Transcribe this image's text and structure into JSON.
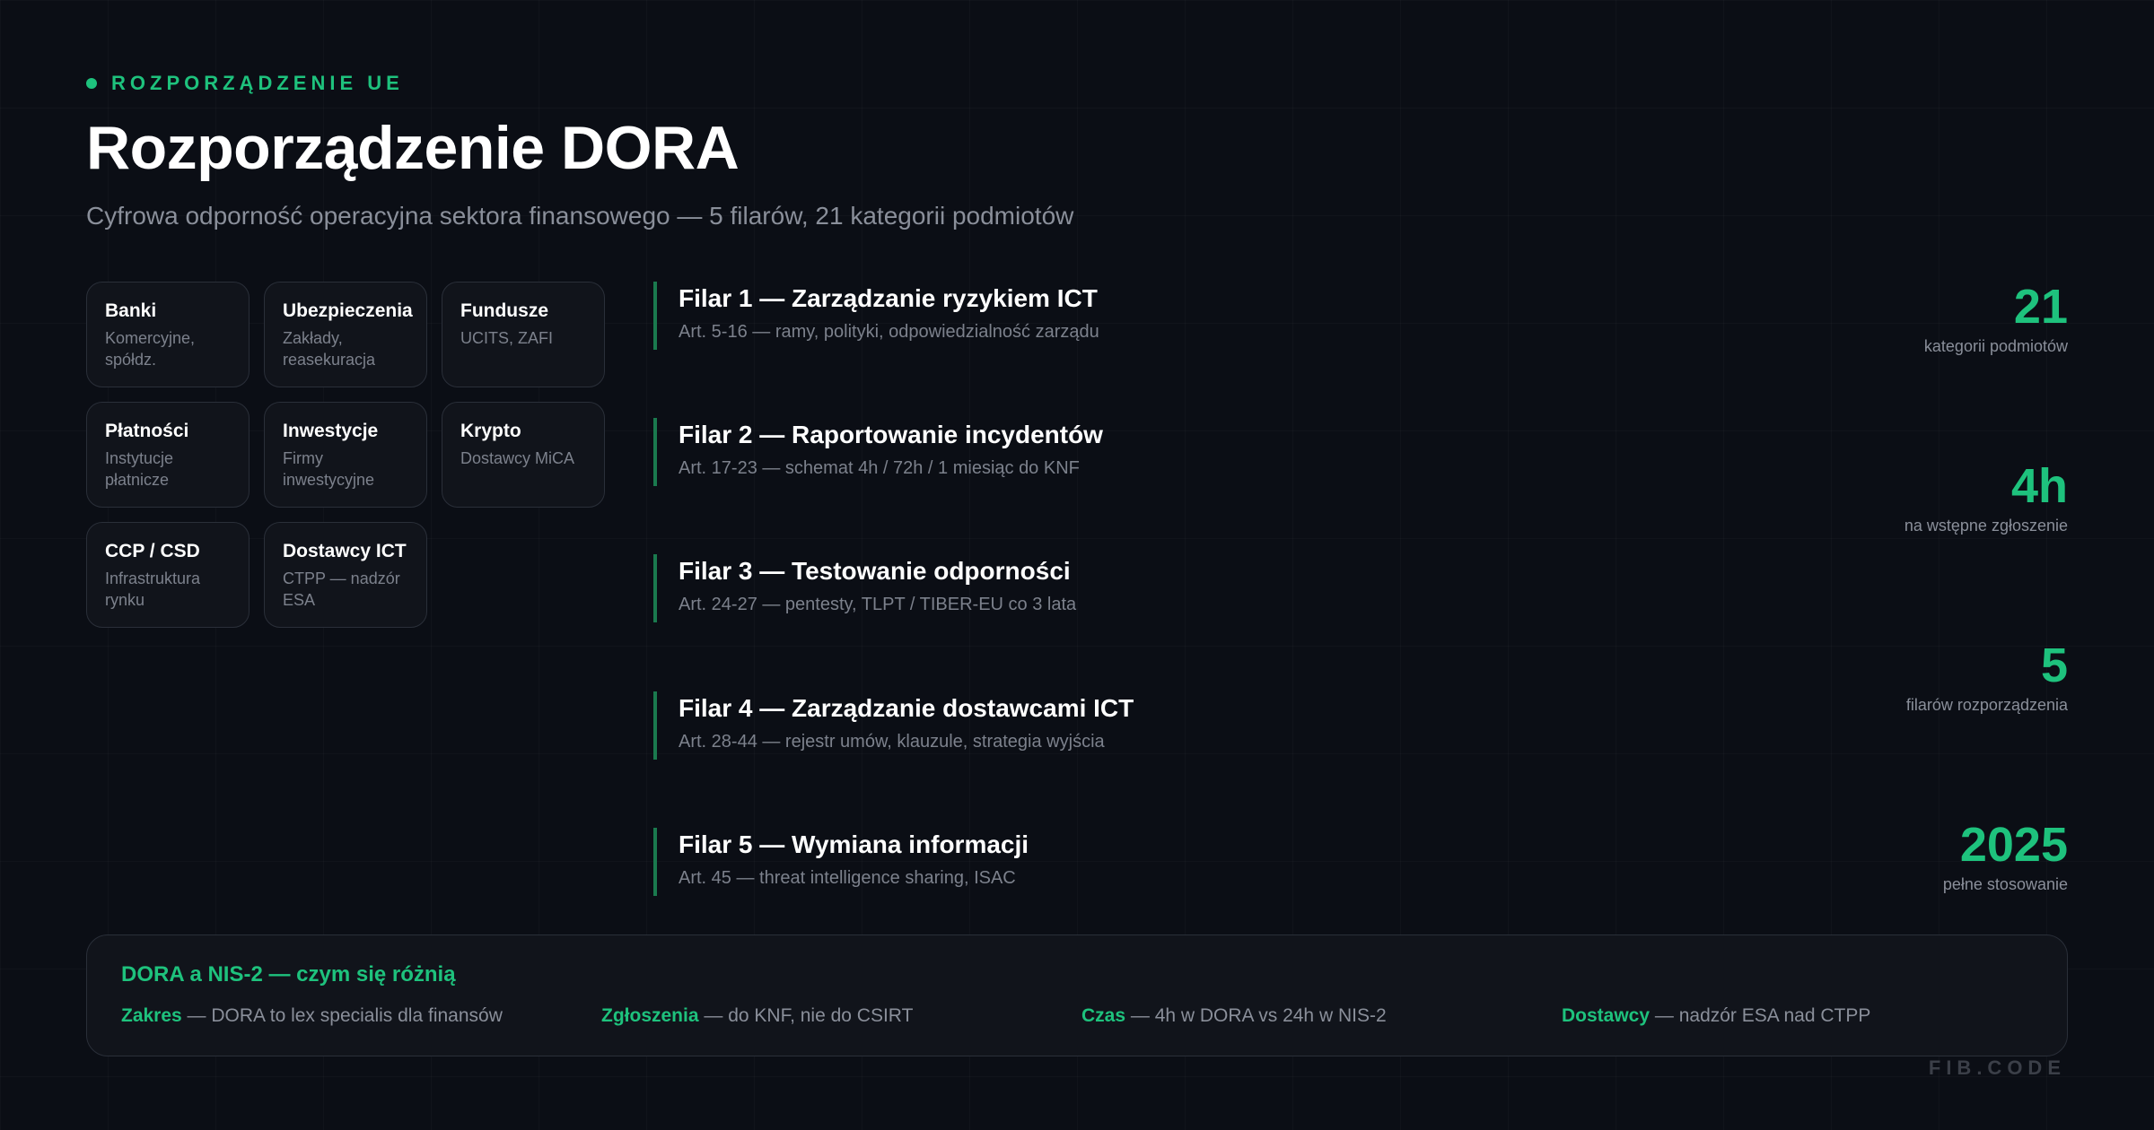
{
  "colors": {
    "accent": "#1ec27d",
    "pillar_bar": "#1a7a4e",
    "muted": "#8a8f9a",
    "background": "#0b0e15"
  },
  "eyebrow": "ROZPORZĄDZENIE UE",
  "title": "Rozporządzenie DORA",
  "subtitle": "Cyfrowa odporność operacyjna sektora finansowego — 5 filarów, 21 kategorii podmiotów",
  "categories": [
    {
      "title": "Banki",
      "desc": "Komercyjne, spółdz."
    },
    {
      "title": "Ubezpieczenia",
      "desc": "Zakłady, reasekuracja"
    },
    {
      "title": "Fundusze",
      "desc": "UCITS, ZAFI"
    },
    {
      "title": "Płatności",
      "desc": "Instytucje płatnicze"
    },
    {
      "title": "Inwestycje",
      "desc": "Firmy inwestycyjne"
    },
    {
      "title": "Krypto",
      "desc": "Dostawcy MiCA"
    },
    {
      "title": "CCP / CSD",
      "desc": "Infrastruktura rynku"
    },
    {
      "title": "Dostawcy ICT",
      "desc": "CTPP — nadzór ESA"
    }
  ],
  "pillars": [
    {
      "title": "Filar 1 — Zarządzanie ryzykiem ICT",
      "desc": "Art. 5-16 — ramy, polityki, odpowiedzialność zarządu"
    },
    {
      "title": "Filar 2 — Raportowanie incydentów",
      "desc": "Art. 17-23 — schemat 4h / 72h / 1 miesiąc do KNF"
    },
    {
      "title": "Filar 3 — Testowanie odporności",
      "desc": "Art. 24-27 — pentesty, TLPT / TIBER-EU co 3 lata"
    },
    {
      "title": "Filar 4 — Zarządzanie dostawcami ICT",
      "desc": "Art. 28-44 — rejestr umów, klauzule, strategia wyjścia"
    },
    {
      "title": "Filar 5 — Wymiana informacji",
      "desc": "Art. 45 — threat intelligence sharing, ISAC"
    }
  ],
  "stats": [
    {
      "value": "21",
      "label": "kategorii podmiotów"
    },
    {
      "value": "4h",
      "label": "na wstępne zgłoszenie"
    },
    {
      "value": "5",
      "label": "filarów rozporządzenia"
    },
    {
      "value": "2025",
      "label": "pełne stosowanie"
    }
  ],
  "comparison": {
    "title": "DORA a NIS-2 — czym się różnią",
    "items": [
      {
        "key": "Zakres",
        "text": " — DORA to lex specialis dla finansów"
      },
      {
        "key": "Zgłoszenia",
        "text": " — do KNF, nie do CSIRT"
      },
      {
        "key": "Czas",
        "text": " — 4h w DORA vs 24h w NIS-2"
      },
      {
        "key": "Dostawcy",
        "text": " — nadzór ESA nad CTPP"
      }
    ]
  },
  "watermark": "FIB.CODE"
}
